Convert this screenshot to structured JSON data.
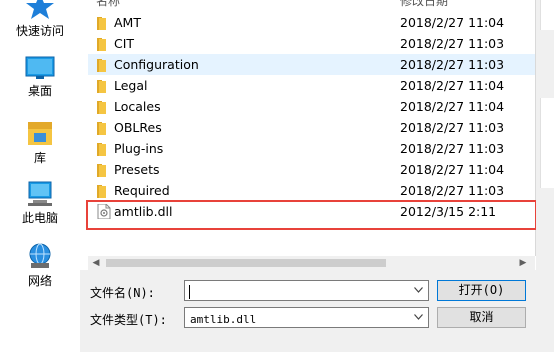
{
  "nav": {
    "items": [
      {
        "label": "快速访问",
        "icon": "star-icon"
      },
      {
        "label": "桌面",
        "icon": "desktop-icon"
      },
      {
        "label": "库",
        "icon": "library-icon"
      },
      {
        "label": "此电脑",
        "icon": "computer-icon"
      },
      {
        "label": "网络",
        "icon": "network-icon"
      }
    ]
  },
  "list": {
    "header_name": "名称",
    "header_date": "修改日期",
    "rows": [
      {
        "name": "AMT",
        "date": "2018/2/27 11:04",
        "type": "folder"
      },
      {
        "name": "CIT",
        "date": "2018/2/27 11:03",
        "type": "folder"
      },
      {
        "name": "Configuration",
        "date": "2018/2/27 11:03",
        "type": "folder"
      },
      {
        "name": "Legal",
        "date": "2018/2/27 11:04",
        "type": "folder"
      },
      {
        "name": "Locales",
        "date": "2018/2/27 11:04",
        "type": "folder"
      },
      {
        "name": "OBLRes",
        "date": "2018/2/27 11:03",
        "type": "folder"
      },
      {
        "name": "Plug-ins",
        "date": "2018/2/27 11:03",
        "type": "folder"
      },
      {
        "name": "Presets",
        "date": "2018/2/27 11:04",
        "type": "folder"
      },
      {
        "name": "Required",
        "date": "2018/2/27 11:03",
        "type": "folder"
      },
      {
        "name": "amtlib.dll",
        "date": "2012/3/15 2:11",
        "type": "dll"
      }
    ]
  },
  "bottom": {
    "filename_label": "文件名(N):",
    "filename_value": "",
    "filetype_label": "文件类型(T):",
    "filetype_value": "amtlib.dll",
    "open_button": "打开(O)",
    "cancel_button": "取消"
  },
  "colors": {
    "folder": "#f5c542",
    "highlight": "#e8423a",
    "selection": "#e5f3ff",
    "accent": "#0078d7"
  }
}
